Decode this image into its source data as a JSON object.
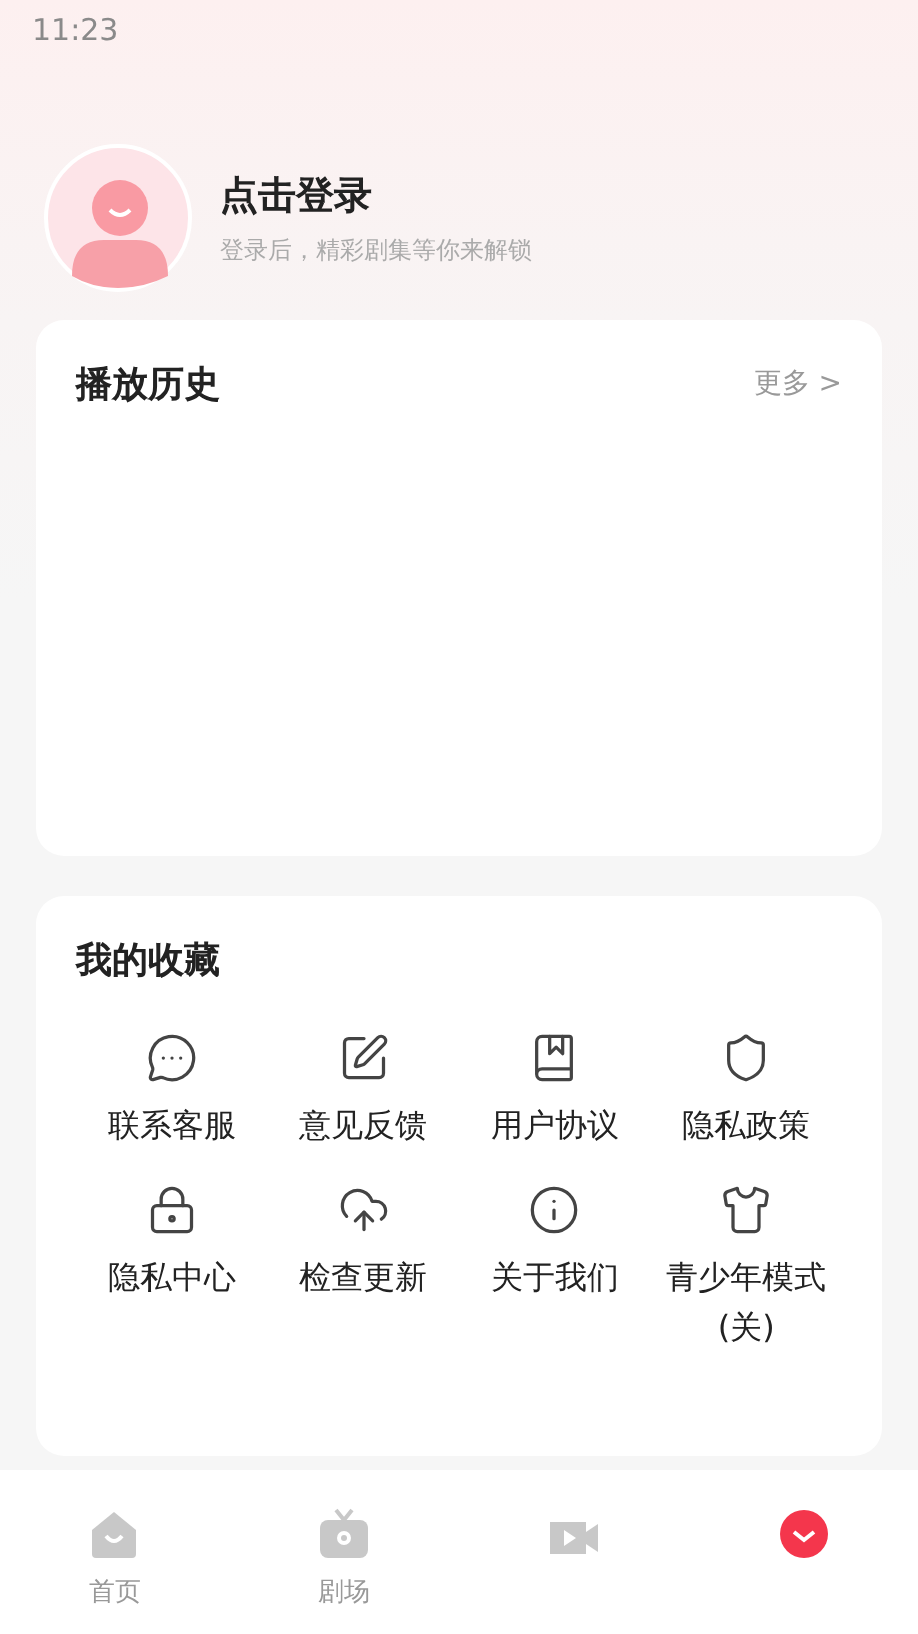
{
  "status_bar": {
    "time": "11:23"
  },
  "profile": {
    "title": "点击登录",
    "subtitle": "登录后，精彩剧集等你来解锁"
  },
  "history": {
    "title": "播放历史",
    "more": "更多 >"
  },
  "favorites": {
    "title": "我的收藏",
    "items": [
      {
        "kind": "chat",
        "label": "联系客服"
      },
      {
        "kind": "edit",
        "label": "意见反馈"
      },
      {
        "kind": "book",
        "label": "用户协议"
      },
      {
        "kind": "shield",
        "label": "隐私政策"
      },
      {
        "kind": "lock",
        "label": "隐私中心"
      },
      {
        "kind": "upload",
        "label": "检查更新"
      },
      {
        "kind": "info",
        "label": "关于我们"
      },
      {
        "kind": "shirt",
        "label": "青少年模式(关)"
      }
    ]
  },
  "tabs": [
    {
      "kind": "home",
      "label": "首页",
      "selected": false
    },
    {
      "kind": "tv",
      "label": "剧场",
      "selected": false
    },
    {
      "kind": "video",
      "selected": false
    },
    {
      "kind": "profile",
      "selected": true
    }
  ]
}
